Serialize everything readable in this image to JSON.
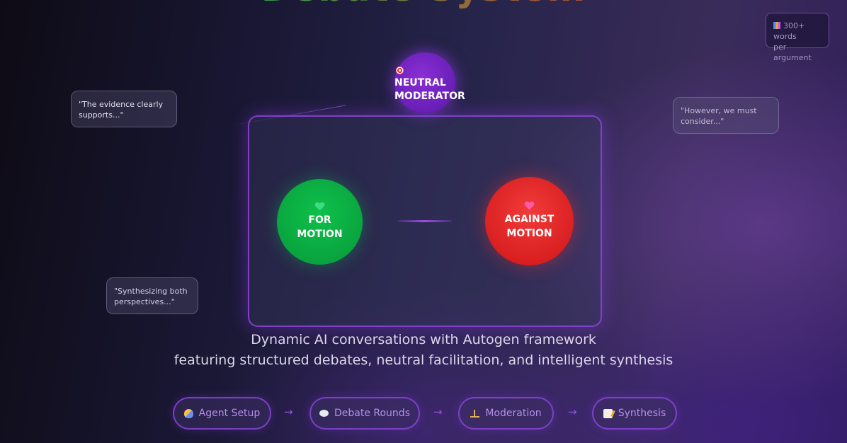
{
  "header": {
    "title": "Debate System"
  },
  "stat_badge": {
    "line1": "300+ words",
    "line2": "per argument",
    "icon": "bar-chart-icon"
  },
  "speech_bubbles": [
    {
      "text": "\"The evidence clearly supports...\""
    },
    {
      "text": "\"However, we must consider...\""
    },
    {
      "text": "\"Synthesizing both perspectives...\""
    }
  ],
  "agents": {
    "moderator": {
      "line1": "NEUTRAL",
      "line2": "MODERATOR",
      "icon": "target-icon",
      "color": "#7a24c9"
    },
    "for": {
      "line1": "FOR",
      "line2": "MOTION",
      "icon": "green-heart-icon",
      "color": "#0ab143"
    },
    "against": {
      "line1": "AGAINST",
      "line2": "MOTION",
      "icon": "pink-heart-icon",
      "color": "#e42222"
    }
  },
  "subtitle": {
    "line1": "Dynamic AI conversations with Autogen framework",
    "line2": "featuring structured debates, neutral facilitation, and intelligent synthesis"
  },
  "workflow": {
    "steps": [
      {
        "label": "Agent Setup",
        "icon": "theater-masks-icon"
      },
      {
        "label": "Debate Rounds",
        "icon": "speech-bubble-icon"
      },
      {
        "label": "Moderation",
        "icon": "balance-scale-icon"
      },
      {
        "label": "Synthesis",
        "icon": "memo-icon"
      }
    ],
    "separator": "→"
  },
  "colors": {
    "accent": "#9b4de6",
    "for": "#0ab143",
    "against": "#e42222",
    "moderator": "#7a24c9"
  }
}
